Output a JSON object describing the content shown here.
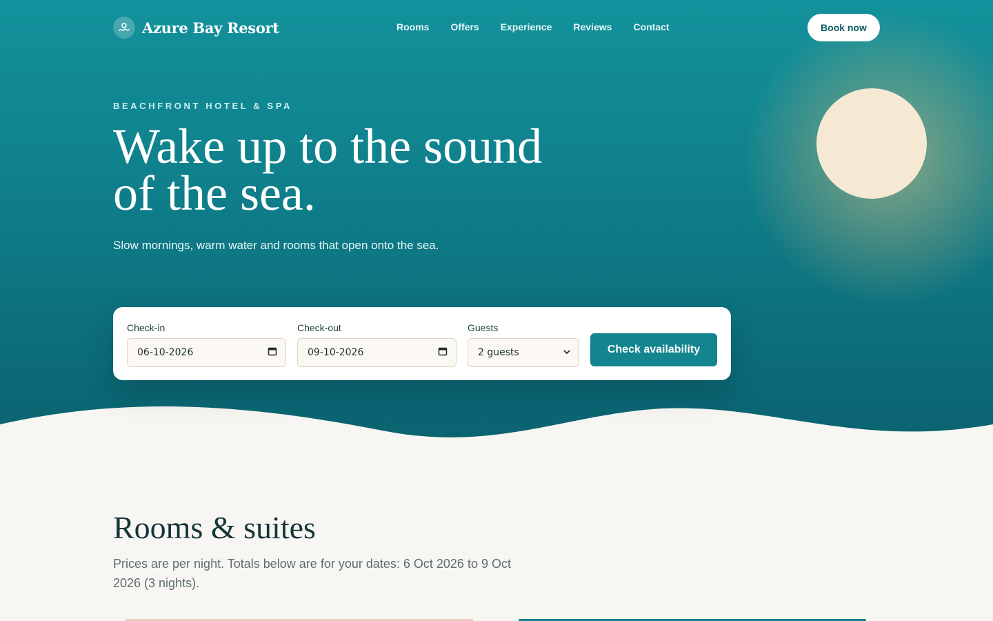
{
  "brand": {
    "name": "Azure Bay Resort",
    "logo_icon": "swimmer-icon"
  },
  "nav": {
    "items": [
      {
        "label": "Rooms"
      },
      {
        "label": "Offers"
      },
      {
        "label": "Experience"
      },
      {
        "label": "Reviews"
      },
      {
        "label": "Contact"
      }
    ],
    "cta_label": "Book now"
  },
  "hero": {
    "eyebrow": "BEACHFRONT HOTEL & SPA",
    "headline": "Wake up to the sound of the sea.",
    "subhead": "Slow mornings, warm water and rooms that open onto the sea."
  },
  "booking": {
    "checkin": {
      "label": "Check-in",
      "value": "06-10-2026",
      "icon": "calendar-icon"
    },
    "checkout": {
      "label": "Check-out",
      "value": "09-10-2026",
      "icon": "calendar-icon"
    },
    "guests": {
      "label": "Guests",
      "value": "2 guests",
      "icon": "chevron-down-icon"
    },
    "submit_label": "Check availability"
  },
  "rooms": {
    "title": "Rooms & suites",
    "description": "Prices are per night. Totals below are for your dates: 6 Oct 2026 to 9 Oct 2026 (3 nights)."
  },
  "colors": {
    "hero_top": "#12929c",
    "hero_bottom": "#0a5f6c",
    "accent": "#13858f",
    "page_bg": "#f8f6f2",
    "sun": "#f5e9d3"
  }
}
